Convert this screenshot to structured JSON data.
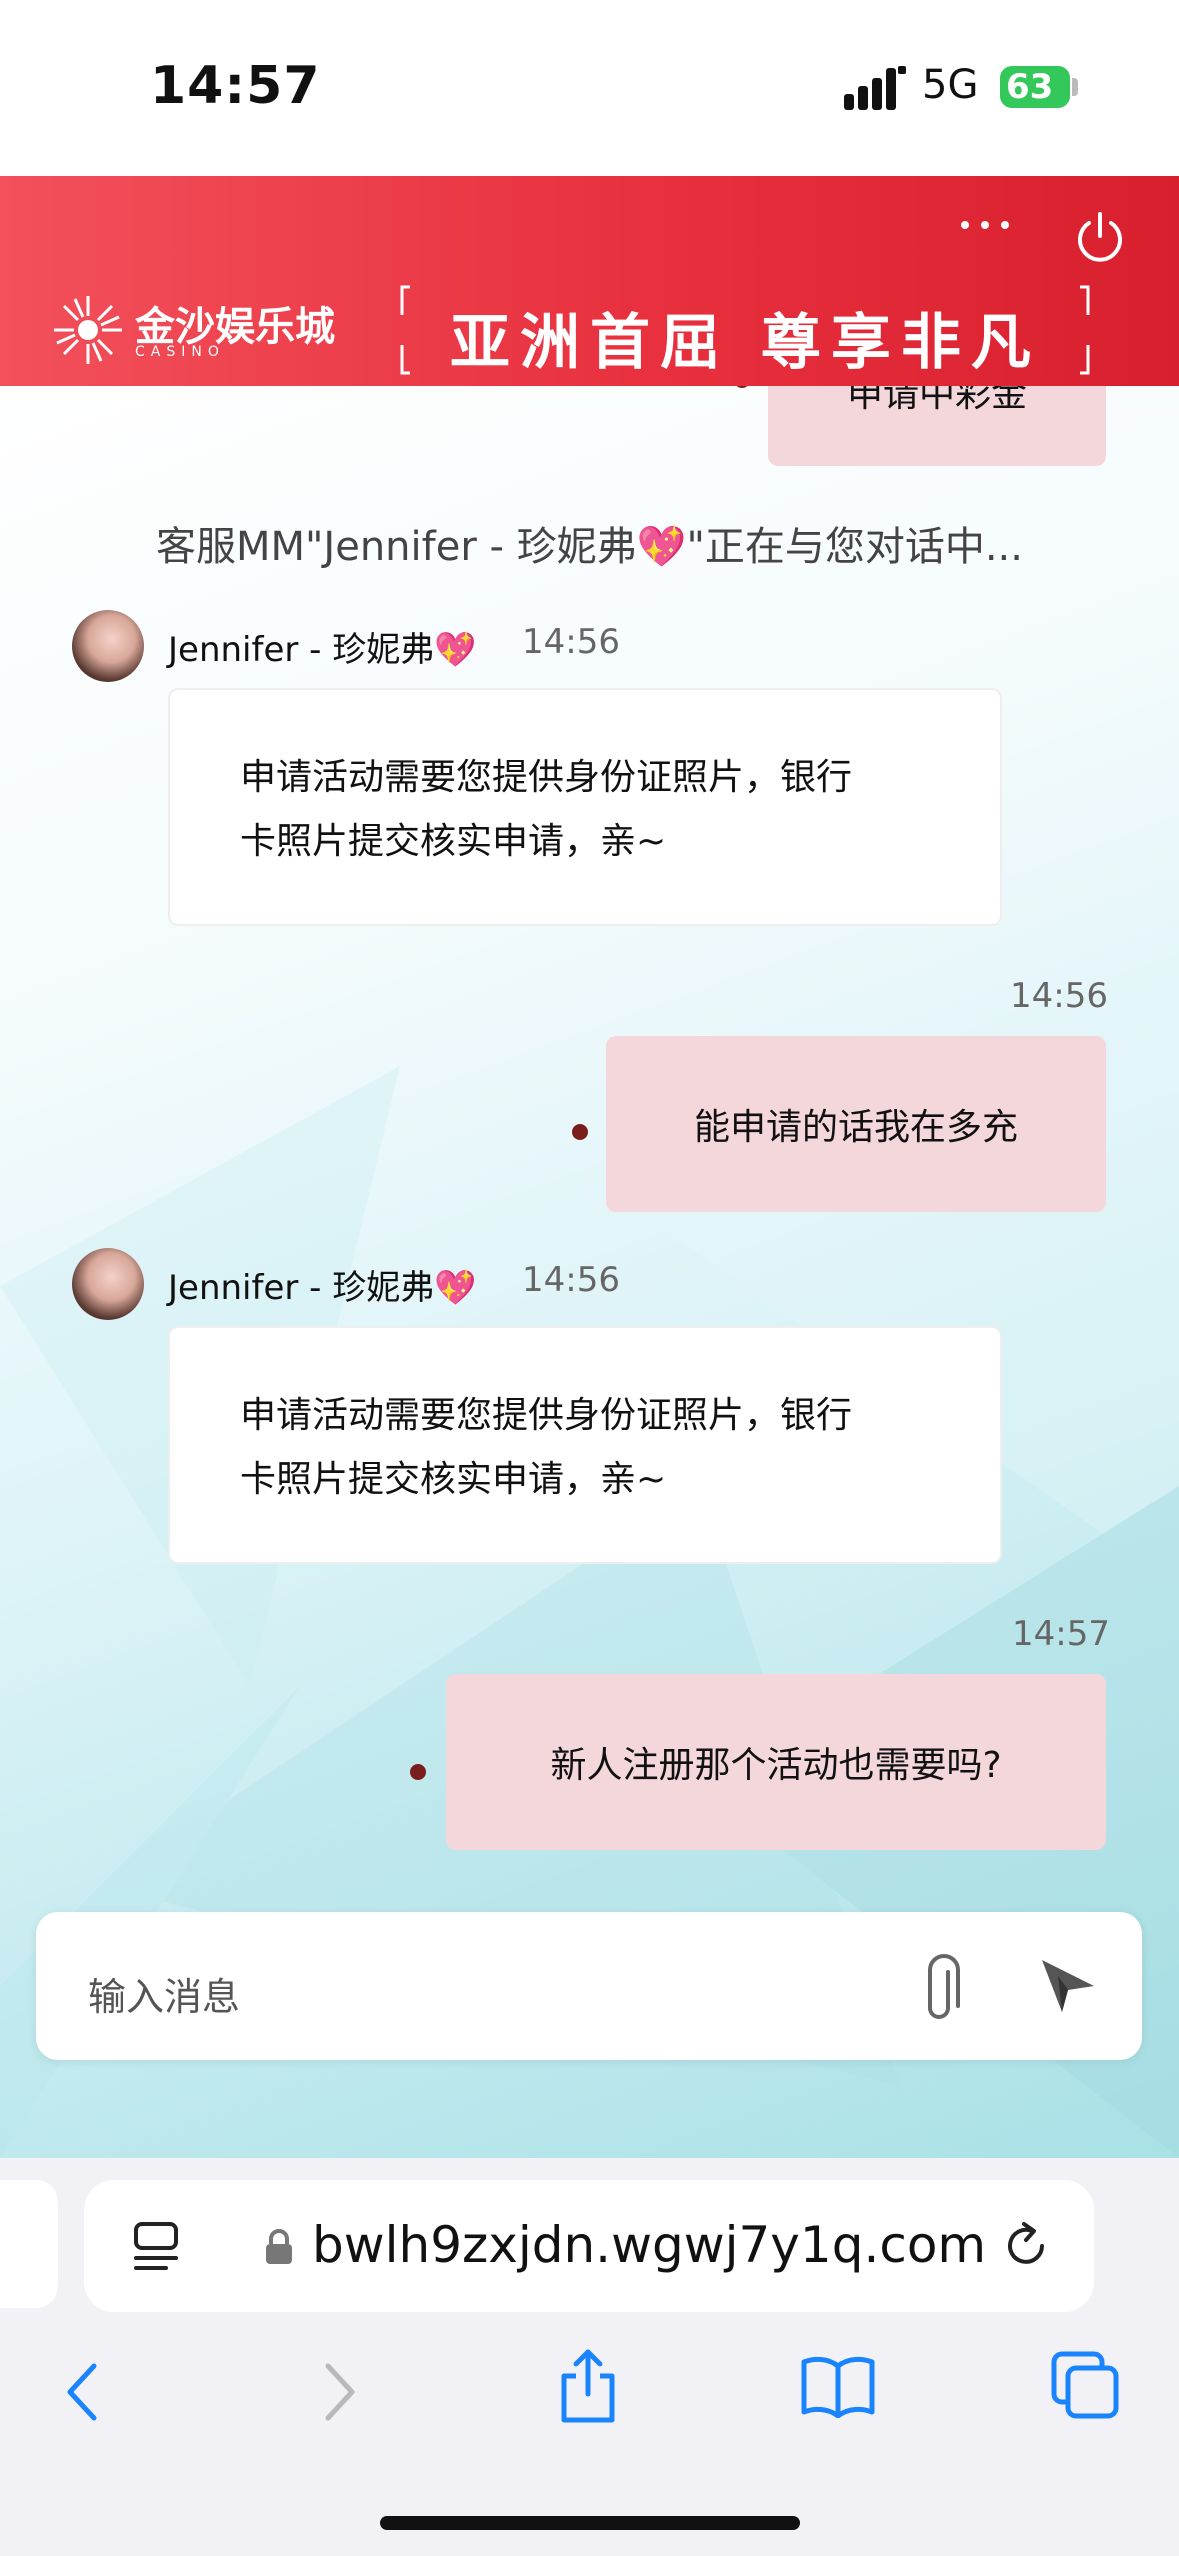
{
  "status_bar": {
    "time": "14:57",
    "network": "5G",
    "battery": "63"
  },
  "header": {
    "logo_text": "金沙娱乐城",
    "logo_sub": "CASINO",
    "slogan": "亚洲首屈  尊享非凡"
  },
  "chat": {
    "notice": "客服MM\"Jennifer - 珍妮弗💖\"正在与您对话中...",
    "partial_message": "申请中彩金",
    "messages": [
      {
        "sender": "Jennifer - 珍妮弗💖",
        "time": "14:56",
        "direction": "in",
        "lines": [
          "申请活动需要您提供身份证照片，银行",
          "卡照片提交核实申请，亲~"
        ]
      },
      {
        "time": "14:56",
        "direction": "out",
        "text": "能申请的话我在多充"
      },
      {
        "sender": "Jennifer - 珍妮弗💖",
        "time": "14:56",
        "direction": "in",
        "lines": [
          "申请活动需要您提供身份证照片，银行",
          "卡照片提交核实申请，亲~"
        ]
      },
      {
        "time": "14:57",
        "direction": "out",
        "text": "新人注册那个活动也需要吗?"
      }
    ]
  },
  "input": {
    "placeholder": "输入消息"
  },
  "browser": {
    "url": "bwlh9zxjdn.wgwj7y1q.com"
  },
  "colors": {
    "header_red": "#e8303e",
    "out_bubble": "#f4d7da",
    "safari_blue": "#1a84ff"
  }
}
